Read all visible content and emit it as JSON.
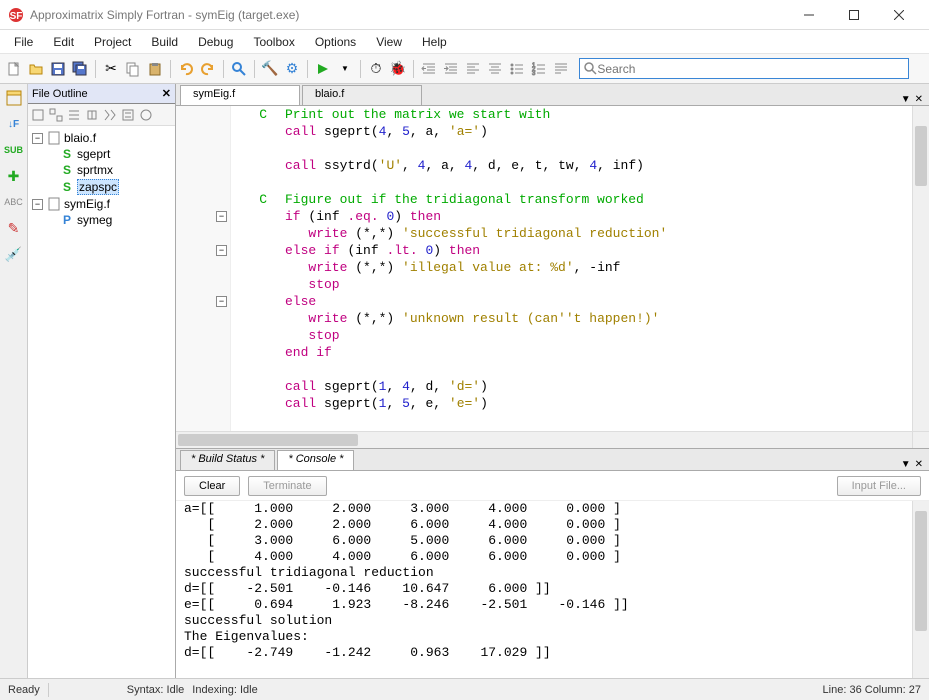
{
  "window": {
    "title": "Approximatrix Simply Fortran - symEig (target.exe)"
  },
  "menu": [
    "File",
    "Edit",
    "Project",
    "Build",
    "Debug",
    "Toolbox",
    "Options",
    "View",
    "Help"
  ],
  "search": {
    "placeholder": "Search"
  },
  "outline": {
    "title": "File Outline",
    "files": [
      {
        "name": "blaio.f",
        "subs": [
          "sgeprt",
          "sprtmx",
          "zapspc"
        ],
        "selected_sub": "zapspc"
      },
      {
        "name": "symEig.f",
        "subs": [
          "symeg"
        ]
      }
    ]
  },
  "editor": {
    "tabs": [
      "symEig.f",
      "blaio.f"
    ],
    "active_tab": 0,
    "code_lines": [
      {
        "col": "C",
        "text": "Print out the matrix we start with",
        "cls": "c"
      },
      {
        "col": "",
        "text": "call sgeprt(4, 5, a, 'a=')",
        "cls": "code"
      },
      {
        "col": "",
        "text": "",
        "cls": ""
      },
      {
        "col": "",
        "text": "call ssytrd('U', 4, a, 4, d, e, t, tw, 4, inf)",
        "cls": "code"
      },
      {
        "col": "",
        "text": "",
        "cls": ""
      },
      {
        "col": "C",
        "text": "Figure out if the tridiagonal transform worked",
        "cls": "c"
      },
      {
        "col": "",
        "text": "if (inf .eq. 0) then",
        "cls": "code"
      },
      {
        "col": "",
        "text": "   write (*,*) 'successful tridiagonal reduction'",
        "cls": "code"
      },
      {
        "col": "",
        "text": "else if (inf .lt. 0) then",
        "cls": "code"
      },
      {
        "col": "",
        "text": "   write (*,*) 'illegal value at: %d', -inf",
        "cls": "code"
      },
      {
        "col": "",
        "text": "   stop",
        "cls": "code"
      },
      {
        "col": "",
        "text": "else",
        "cls": "code"
      },
      {
        "col": "",
        "text": "   write (*,*) 'unknown result (can''t happen!)'",
        "cls": "code"
      },
      {
        "col": "",
        "text": "   stop",
        "cls": "code"
      },
      {
        "col": "",
        "text": "end if",
        "cls": "code"
      },
      {
        "col": "",
        "text": "",
        "cls": ""
      },
      {
        "col": "",
        "text": "call sgeprt(1, 4, d, 'd=')",
        "cls": "code"
      },
      {
        "col": "",
        "text": "call sgeprt(1, 5, e, 'e=')",
        "cls": "code"
      }
    ]
  },
  "bottom": {
    "tabs": [
      "* Build Status *",
      "* Console *"
    ],
    "active_tab": 1,
    "buttons": {
      "clear": "Clear",
      "terminate": "Terminate",
      "input_file": "Input File..."
    },
    "console": "a=[[     1.000     2.000     3.000     4.000     0.000 ]\n   [     2.000     2.000     6.000     4.000     0.000 ]\n   [     3.000     6.000     5.000     6.000     0.000 ]\n   [     4.000     4.000     6.000     6.000     0.000 ]\nsuccessful tridiagonal reduction\nd=[[    -2.501    -0.146    10.647     6.000 ]]\ne=[[     0.694     1.923    -8.246    -2.501    -0.146 ]]\nsuccessful solution\nThe Eigenvalues:\nd=[[    -2.749    -1.242     0.963    17.029 ]]"
  },
  "status": {
    "ready": "Ready",
    "syntax": "Syntax: Idle",
    "indexing": "Indexing: Idle",
    "position": "Line: 36 Column: 27"
  }
}
